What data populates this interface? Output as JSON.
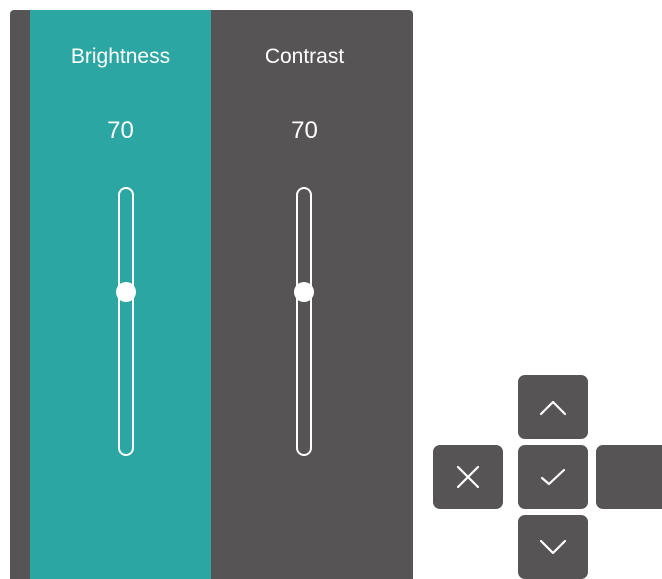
{
  "osd": {
    "brightness": {
      "label": "Brightness",
      "value": "70",
      "level_percent": 39
    },
    "contrast": {
      "label": "Contrast",
      "value": "70",
      "level_percent": 39
    }
  },
  "colors": {
    "panel": "#575455",
    "accent": "#2ba6a2",
    "text": "#ffffff"
  },
  "controls": {
    "up": "chevron-up-icon",
    "close": "close-icon",
    "ok": "check-icon",
    "down": "chevron-down-icon"
  }
}
